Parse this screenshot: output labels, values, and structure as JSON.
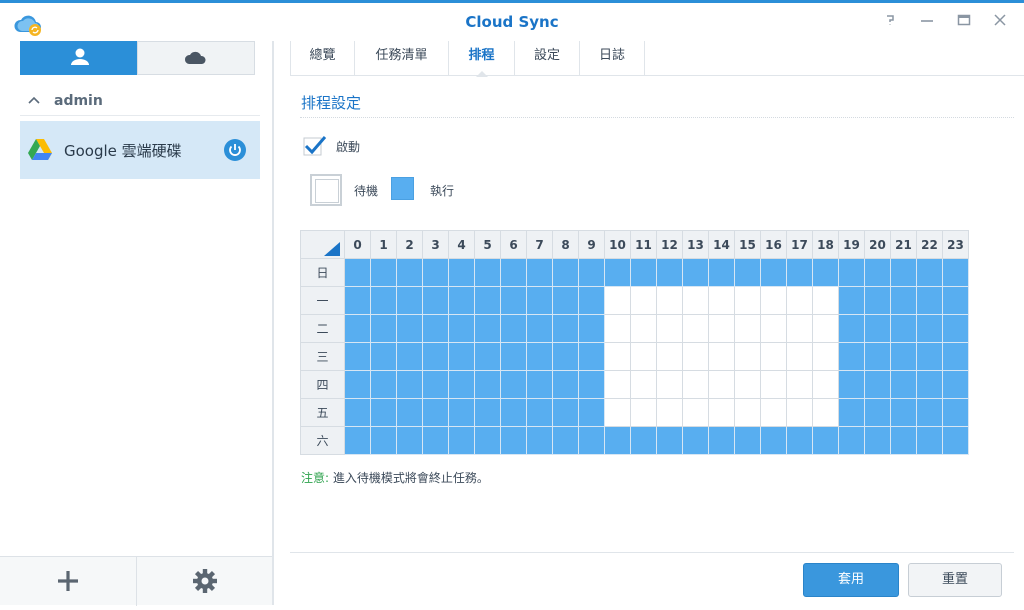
{
  "window": {
    "title": "Cloud Sync",
    "controls": [
      "help-icon",
      "minimize-icon",
      "maximize-icon",
      "close-icon"
    ]
  },
  "sidebar": {
    "segments": [
      {
        "icon": "user-icon",
        "active": true
      },
      {
        "icon": "cloud-icon",
        "active": false
      }
    ],
    "account": {
      "name": "admin",
      "expanded": true
    },
    "tasks": [
      {
        "label": "Google 雲端硬碟",
        "icon": "google-drive-icon",
        "status_icon": "power-icon",
        "selected": true
      }
    ],
    "bottom_buttons": [
      {
        "icon": "plus-icon"
      },
      {
        "icon": "gear-icon"
      }
    ]
  },
  "tabs": [
    {
      "label": "總覽",
      "active": false
    },
    {
      "label": "任務清單",
      "active": false
    },
    {
      "label": "排程",
      "active": true
    },
    {
      "label": "設定",
      "active": false
    },
    {
      "label": "日誌",
      "active": false
    }
  ],
  "schedule": {
    "section_title": "排程設定",
    "enable_label": "啟動",
    "enabled": true,
    "legend": {
      "standby": "待機",
      "run": "執行"
    },
    "hours": [
      "0",
      "1",
      "2",
      "3",
      "4",
      "5",
      "6",
      "7",
      "8",
      "9",
      "10",
      "11",
      "12",
      "13",
      "14",
      "15",
      "16",
      "17",
      "18",
      "19",
      "20",
      "21",
      "22",
      "23"
    ],
    "days": [
      "日",
      "一",
      "二",
      "三",
      "四",
      "五",
      "六"
    ],
    "grid": [
      [
        1,
        1,
        1,
        1,
        1,
        1,
        1,
        1,
        1,
        1,
        1,
        1,
        1,
        1,
        1,
        1,
        1,
        1,
        1,
        1,
        1,
        1,
        1,
        1
      ],
      [
        1,
        1,
        1,
        1,
        1,
        1,
        1,
        1,
        1,
        1,
        0,
        0,
        0,
        0,
        0,
        0,
        0,
        0,
        0,
        1,
        1,
        1,
        1,
        1
      ],
      [
        1,
        1,
        1,
        1,
        1,
        1,
        1,
        1,
        1,
        1,
        0,
        0,
        0,
        0,
        0,
        0,
        0,
        0,
        0,
        1,
        1,
        1,
        1,
        1
      ],
      [
        1,
        1,
        1,
        1,
        1,
        1,
        1,
        1,
        1,
        1,
        0,
        0,
        0,
        0,
        0,
        0,
        0,
        0,
        0,
        1,
        1,
        1,
        1,
        1
      ],
      [
        1,
        1,
        1,
        1,
        1,
        1,
        1,
        1,
        1,
        1,
        0,
        0,
        0,
        0,
        0,
        0,
        0,
        0,
        0,
        1,
        1,
        1,
        1,
        1
      ],
      [
        1,
        1,
        1,
        1,
        1,
        1,
        1,
        1,
        1,
        1,
        0,
        0,
        0,
        0,
        0,
        0,
        0,
        0,
        0,
        1,
        1,
        1,
        1,
        1
      ],
      [
        1,
        1,
        1,
        1,
        1,
        1,
        1,
        1,
        1,
        1,
        1,
        1,
        1,
        1,
        1,
        1,
        1,
        1,
        1,
        1,
        1,
        1,
        1,
        1
      ]
    ],
    "note_label": "注意:",
    "note_text": " 進入待機模式將會終止任務。"
  },
  "footer": {
    "apply_label": "套用",
    "reset_label": "重置"
  },
  "colors": {
    "accent": "#2b8fd8",
    "run_cell": "#58aef0",
    "note_label": "#2fa34e"
  }
}
